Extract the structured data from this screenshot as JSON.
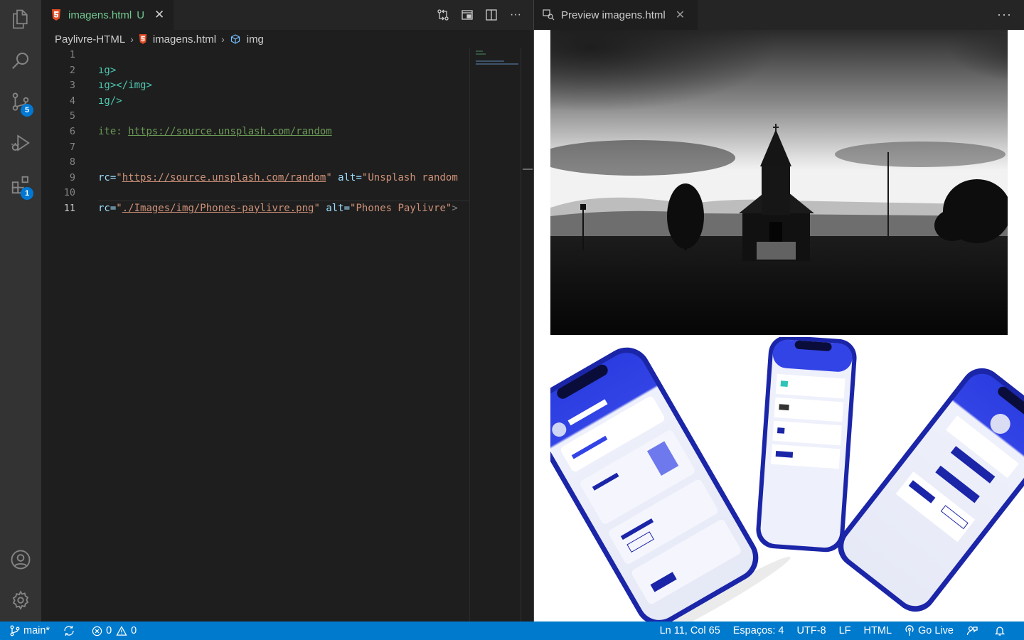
{
  "activity_bar": {
    "items": [
      {
        "name": "explorer"
      },
      {
        "name": "search"
      },
      {
        "name": "source-control",
        "badge": "5"
      },
      {
        "name": "run-and-debug"
      },
      {
        "name": "extensions",
        "badge": "1"
      }
    ],
    "bottom": [
      {
        "name": "accounts"
      },
      {
        "name": "manage"
      }
    ]
  },
  "editor": {
    "tab": {
      "label": "imagens.html",
      "status": "U",
      "close": "✕"
    },
    "breadcrumb": {
      "root": "Paylivre-HTML",
      "file": "imagens.html",
      "symbol": "img"
    },
    "line_numbers": [
      "1",
      "2",
      "3",
      "4",
      "5",
      "6",
      "7",
      "8",
      "9",
      "10",
      "11"
    ],
    "active_line": "11",
    "code_lines": [
      [],
      [
        {
          "t": "ıg>",
          "c": "tag"
        }
      ],
      [
        {
          "t": "ıg>",
          "c": "tag"
        },
        {
          "t": "</",
          "c": "tag"
        },
        {
          "t": "img",
          "c": "tag"
        },
        {
          "t": ">",
          "c": "tag"
        }
      ],
      [
        {
          "t": "ıg/>",
          "c": "tag"
        }
      ],
      [],
      [
        {
          "t": "ite: ",
          "c": "cmt"
        },
        {
          "t": "https://source.unsplash.com/random",
          "c": "url"
        }
      ],
      [],
      [],
      [
        {
          "t": "rc=",
          "c": "attr"
        },
        {
          "t": "\"",
          "c": "str"
        },
        {
          "t": "https://source.unsplash.com/random",
          "c": "strlink"
        },
        {
          "t": "\"",
          "c": "str"
        },
        {
          "t": " alt=",
          "c": "attr"
        },
        {
          "t": "\"Unsplash random",
          "c": "str"
        }
      ],
      [],
      [
        {
          "t": "rc=",
          "c": "attr"
        },
        {
          "t": "\"",
          "c": "str"
        },
        {
          "t": "./Images/img/Phones-paylivre.png",
          "c": "strlink"
        },
        {
          "t": "\"",
          "c": "str"
        },
        {
          "t": " alt=",
          "c": "attr"
        },
        {
          "t": "\"Phones Paylivre\"",
          "c": "str"
        },
        {
          "t": ">",
          "c": "punc"
        }
      ]
    ]
  },
  "preview": {
    "tab": {
      "label": "Preview imagens.html",
      "close": "✕"
    },
    "more": "···"
  },
  "status_bar": {
    "branch": "main*",
    "errors": "0",
    "warnings": "0",
    "cursor": "Ln 11, Col 65",
    "spaces": "Espaços: 4",
    "encoding": "UTF-8",
    "eol": "LF",
    "language": "HTML",
    "golive": "Go Live"
  },
  "colors": {
    "accent": "#007acc",
    "badge": "#0078d4",
    "untracked": "#73c991",
    "html_icon": "#e44d26"
  }
}
